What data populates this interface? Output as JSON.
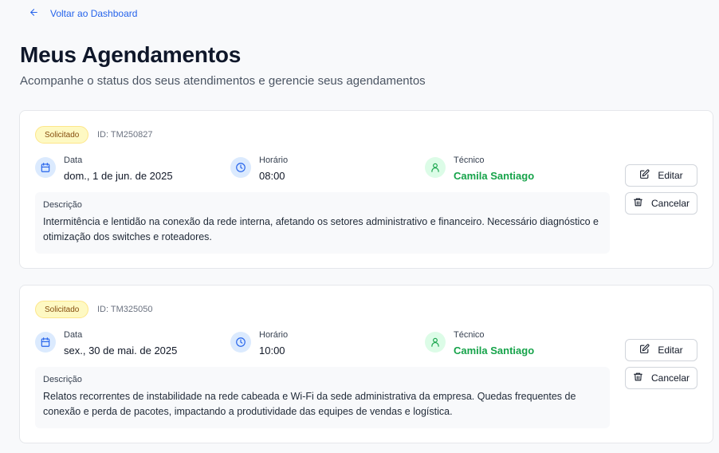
{
  "nav": {
    "back_label": "Voltar ao Dashboard"
  },
  "header": {
    "title": "Meus Agendamentos",
    "subtitle": "Acompanhe o status dos seus atendimentos e gerencie seus agendamentos"
  },
  "appointments": [
    {
      "status": "Solicitado",
      "id": "ID: TM250827",
      "date_label": "Data",
      "date": "dom., 1 de jun. de 2025",
      "time_label": "Horário",
      "time": "08:00",
      "tech_label": "Técnico",
      "tech": "Camila Santiago",
      "desc_label": "Descrição",
      "desc": "Intermitência e lentidão na conexão da rede interna, afetando os setores administrativo e financeiro. Necessário diagnóstico e otimização dos switches e roteadores.",
      "edit_label": "Editar",
      "cancel_label": "Cancelar"
    },
    {
      "status": "Solicitado",
      "id": "ID: TM325050",
      "date_label": "Data",
      "date": "sex., 30 de mai. de 2025",
      "time_label": "Horário",
      "time": "10:00",
      "tech_label": "Técnico",
      "tech": "Camila Santiago",
      "desc_label": "Descrição",
      "desc": "Relatos recorrentes de instabilidade na rede cabeada e Wi-Fi da sede administrativa da empresa. Quedas frequentes de conexão e perda de pacotes, impactando a produtividade das equipes de vendas e logística.",
      "edit_label": "Editar",
      "cancel_label": "Cancelar"
    }
  ],
  "icons": {
    "back": "arrow-left-icon",
    "date": "calendar-icon",
    "time": "clock-icon",
    "tech": "user-icon",
    "edit": "edit-icon",
    "cancel": "trash-icon"
  },
  "colors": {
    "accent": "#2563eb",
    "tech_name": "#16a34a",
    "badge_bg": "#fef9c3",
    "badge_text": "#854d0e"
  }
}
